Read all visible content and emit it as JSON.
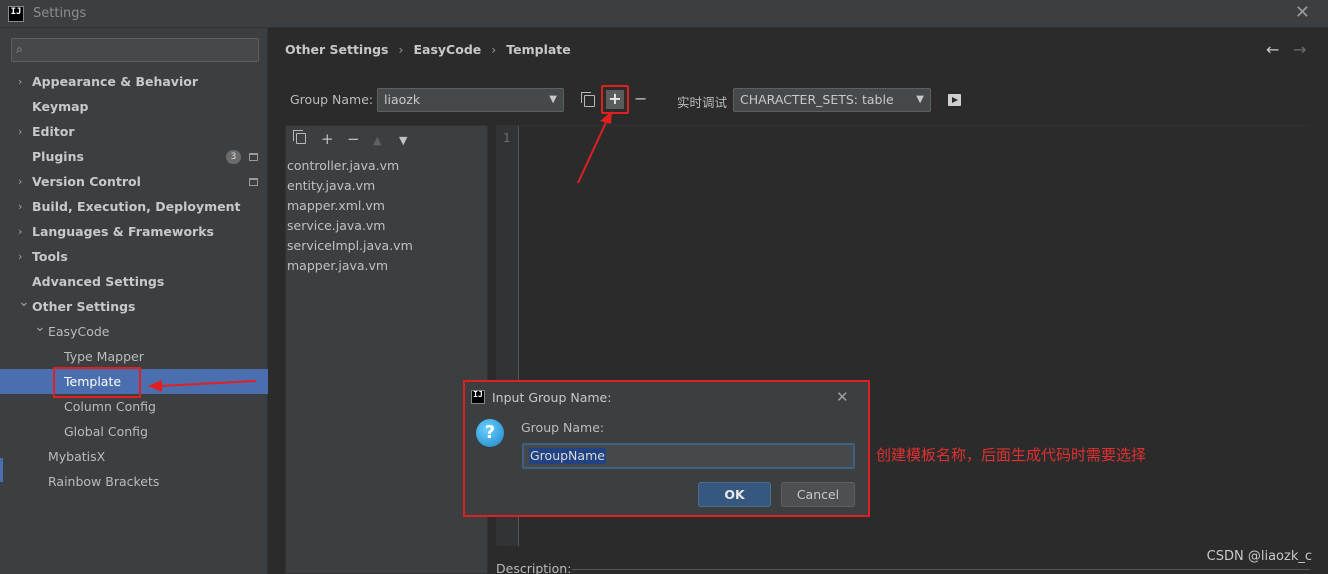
{
  "window": {
    "title": "Settings",
    "logo_text": "IJ"
  },
  "sidebar": {
    "search_placeholder": "",
    "items": [
      {
        "label": "Appearance & Behavior",
        "expandable": true,
        "bold": true,
        "level": 0
      },
      {
        "label": "Keymap",
        "expandable": false,
        "bold": true,
        "level": 0
      },
      {
        "label": "Editor",
        "expandable": true,
        "bold": true,
        "level": 0
      },
      {
        "label": "Plugins",
        "expandable": false,
        "bold": true,
        "level": 0,
        "badge": "3"
      },
      {
        "label": "Version Control",
        "expandable": true,
        "bold": true,
        "level": 0
      },
      {
        "label": "Build, Execution, Deployment",
        "expandable": true,
        "bold": true,
        "level": 0
      },
      {
        "label": "Languages & Frameworks",
        "expandable": true,
        "bold": true,
        "level": 0
      },
      {
        "label": "Tools",
        "expandable": true,
        "bold": true,
        "level": 0
      },
      {
        "label": "Advanced Settings",
        "expandable": false,
        "bold": true,
        "level": 0
      },
      {
        "label": "Other Settings",
        "expandable": true,
        "expanded": true,
        "bold": true,
        "level": 0
      },
      {
        "label": "EasyCode",
        "expandable": true,
        "expanded": true,
        "bold": false,
        "level": 1
      },
      {
        "label": "Type Mapper",
        "level": 2
      },
      {
        "label": "Template",
        "level": 2,
        "selected": true
      },
      {
        "label": "Column Config",
        "level": 2
      },
      {
        "label": "Global Config",
        "level": 2
      },
      {
        "label": "MybatisX",
        "level": 1
      },
      {
        "label": "Rainbow Brackets",
        "level": 1
      }
    ]
  },
  "breadcrumb": [
    "Other Settings",
    "EasyCode",
    "Template"
  ],
  "toolbar": {
    "group_name_label": "Group Name:",
    "group_name_value": "liaozk",
    "realtime_debug_label": "实时调试",
    "realtime_debug_value": "CHARACTER_SETS: table"
  },
  "files": [
    "controller.java.vm",
    "entity.java.vm",
    "mapper.xml.vm",
    "service.java.vm",
    "serviceImpl.java.vm",
    "mapper.java.vm"
  ],
  "editor": {
    "line_number": "1"
  },
  "description_label": "Description:",
  "dialog": {
    "title": "Input Group Name:",
    "field_label": "Group Name:",
    "field_value": "GroupName",
    "ok_label": "OK",
    "cancel_label": "Cancel"
  },
  "annotation": {
    "note": "创建模板名称，后面生成代码时需要选择",
    "color": "#e02020"
  },
  "watermark": "CSDN @liaozk_c"
}
